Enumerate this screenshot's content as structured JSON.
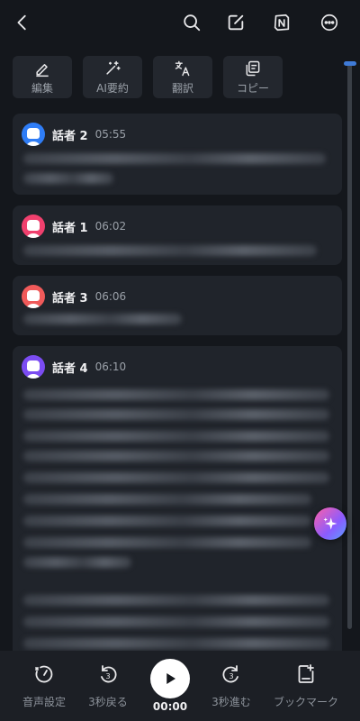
{
  "header": {
    "icons": [
      "back-icon",
      "search-icon",
      "edit-note-icon",
      "notion-icon",
      "more-icon"
    ]
  },
  "toolbar": {
    "edit_label": "編集",
    "ai_summary_label": "AI要約",
    "translate_label": "翻訳",
    "copy_label": "コピー"
  },
  "transcript": [
    {
      "speaker": "話者 2",
      "time": "05:55",
      "avatar_color": "#2f7df6"
    },
    {
      "speaker": "話者 1",
      "time": "06:02",
      "avatar_color": "#f0406e"
    },
    {
      "speaker": "話者 3",
      "time": "06:06",
      "avatar_color": "#f05a5a"
    },
    {
      "speaker": "話者 4",
      "time": "06:10",
      "avatar_color": "#7b4cf2"
    }
  ],
  "player": {
    "speed_label": "音声設定",
    "rewind_label": "3秒戻る",
    "elapsed": "00:00",
    "forward_label": "3秒進む",
    "bookmark_label": "ブックマーク"
  },
  "colors": {
    "background": "#14171c",
    "card": "#20242b",
    "accent": "#3f7bd8"
  }
}
